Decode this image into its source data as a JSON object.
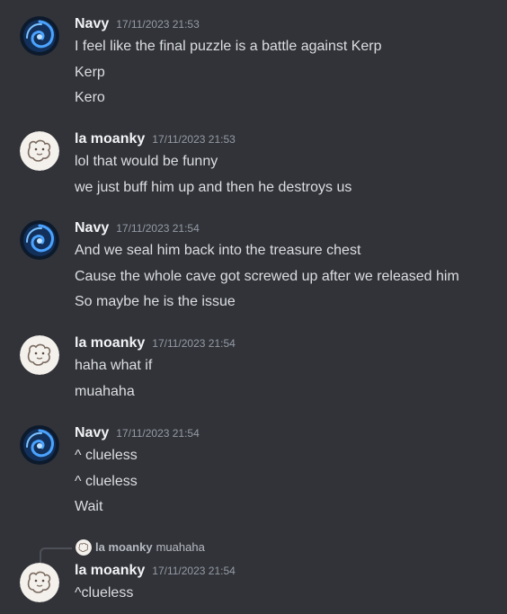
{
  "messages": [
    {
      "author": "Navy",
      "time": "17/11/2023 21:53",
      "avatar": "navy-swirl-avatar",
      "lines": [
        "I feel like the final puzzle is a battle against Kerp",
        "Kerp",
        "Kero"
      ]
    },
    {
      "author": "la moanky",
      "time": "17/11/2023 21:53",
      "avatar": "sketch-creature-avatar",
      "lines": [
        "lol that would be funny",
        "we just buff him up and then he destroys us"
      ]
    },
    {
      "author": "Navy",
      "time": "17/11/2023 21:54",
      "avatar": "navy-swirl-avatar",
      "lines": [
        "And we seal him back into the treasure chest",
        "Cause the whole cave got screwed up after we released him",
        "So maybe he is the issue"
      ]
    },
    {
      "author": "la moanky",
      "time": "17/11/2023 21:54",
      "avatar": "sketch-creature-avatar",
      "lines": [
        "haha what if",
        "muahaha"
      ]
    },
    {
      "author": "Navy",
      "time": "17/11/2023 21:54",
      "avatar": "navy-swirl-avatar",
      "lines": [
        "^ clueless",
        "^ clueless",
        "Wait"
      ]
    },
    {
      "author": "la moanky",
      "time": "17/11/2023 21:54",
      "avatar": "sketch-creature-avatar",
      "lines": [
        "^clueless"
      ],
      "reply_to": {
        "author": "la moanky",
        "content": "muahaha"
      }
    }
  ],
  "colors": {
    "background": "#323339",
    "author": "#f2f3f5",
    "timestamp": "#949ba4",
    "text": "#dbdee1"
  }
}
